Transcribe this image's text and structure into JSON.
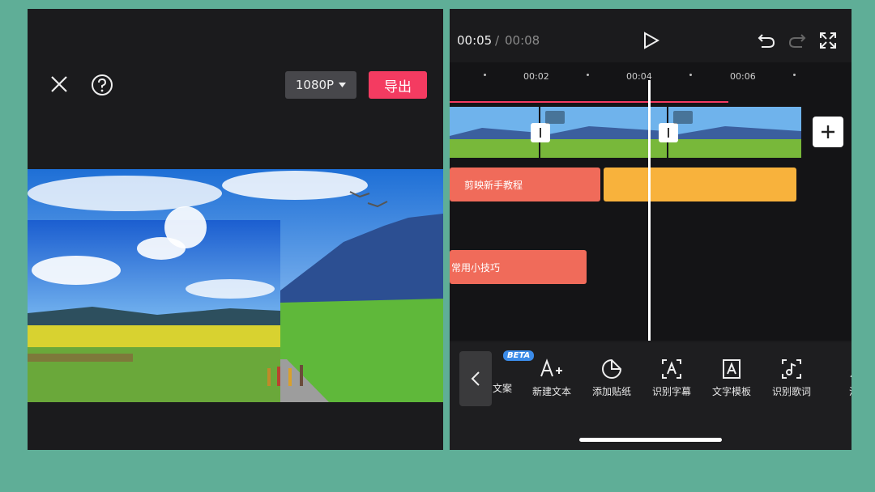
{
  "export_panel": {
    "resolution_label": "1080P",
    "export_label": "导出",
    "icons": [
      "close-icon",
      "help-icon",
      "dropdown-icon"
    ]
  },
  "editor": {
    "time_current": "00:05",
    "time_separator": "/",
    "time_total": "00:08",
    "ruler_ticks": [
      "00:02",
      "00:04",
      "00:06"
    ],
    "text_clips": [
      "剪映新手教程",
      "常用小技巧"
    ],
    "tools": [
      {
        "label": "文案",
        "icon": "copywriting-icon",
        "badge": "BETA"
      },
      {
        "label": "新建文本",
        "icon": "add-text-icon"
      },
      {
        "label": "添加贴纸",
        "icon": "sticker-icon"
      },
      {
        "label": "识别字幕",
        "icon": "recognize-subtitle-icon"
      },
      {
        "label": "文字模板",
        "icon": "text-template-icon"
      },
      {
        "label": "识别歌词",
        "icon": "recognize-lyrics-icon"
      },
      {
        "label": "涂鸦",
        "icon": "doodle-icon"
      }
    ]
  },
  "colors": {
    "accent": "#f43b61",
    "text_clip_red": "#f06b5a",
    "text_clip_orange": "#f8b23c",
    "background": "#5fae97"
  }
}
